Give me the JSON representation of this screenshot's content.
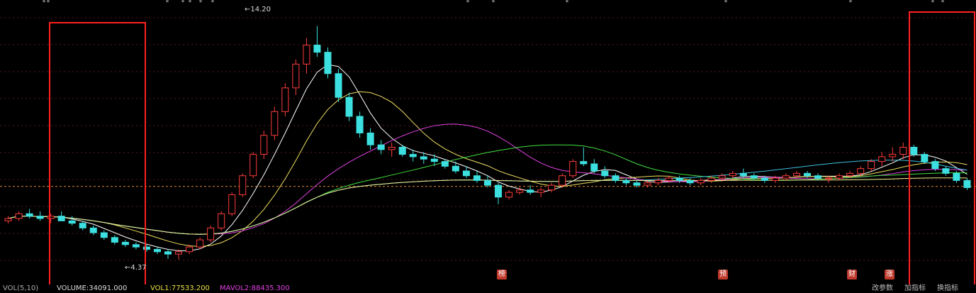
{
  "chart_data": {
    "type": "candlestick",
    "ylim": [
      3.5,
      15.0
    ],
    "high_label": "14.20",
    "low_label": "4.37",
    "reference_price": 7.45,
    "ohlc": [
      [
        6.0,
        6.2,
        5.9,
        6.1
      ],
      [
        6.1,
        6.4,
        6.0,
        6.3
      ],
      [
        6.3,
        6.5,
        6.1,
        6.2
      ],
      [
        6.2,
        6.4,
        6.0,
        6.1
      ],
      [
        6.1,
        6.3,
        5.9,
        6.2
      ],
      [
        6.2,
        6.4,
        6.0,
        6.0
      ],
      [
        6.0,
        6.2,
        5.8,
        5.9
      ],
      [
        5.9,
        6.0,
        5.6,
        5.7
      ],
      [
        5.7,
        5.8,
        5.4,
        5.5
      ],
      [
        5.5,
        5.6,
        5.2,
        5.3
      ],
      [
        5.3,
        5.4,
        5.0,
        5.1
      ],
      [
        5.1,
        5.2,
        4.9,
        5.0
      ],
      [
        5.0,
        5.1,
        4.8,
        4.9
      ],
      [
        4.9,
        5.0,
        4.7,
        4.8
      ],
      [
        4.8,
        4.9,
        4.6,
        4.7
      ],
      [
        4.7,
        4.8,
        4.4,
        4.6
      ],
      [
        4.6,
        4.8,
        4.37,
        4.7
      ],
      [
        4.7,
        5.0,
        4.6,
        4.9
      ],
      [
        4.9,
        5.3,
        4.8,
        5.2
      ],
      [
        5.2,
        5.8,
        5.1,
        5.7
      ],
      [
        5.7,
        6.4,
        5.6,
        6.3
      ],
      [
        6.3,
        7.2,
        6.2,
        7.1
      ],
      [
        7.1,
        8.0,
        7.0,
        7.9
      ],
      [
        7.9,
        8.9,
        7.8,
        8.8
      ],
      [
        8.8,
        9.8,
        8.6,
        9.6
      ],
      [
        9.6,
        10.8,
        9.4,
        10.6
      ],
      [
        10.6,
        11.8,
        10.4,
        11.6
      ],
      [
        11.6,
        12.8,
        11.3,
        12.6
      ],
      [
        12.6,
        13.7,
        12.2,
        13.4
      ],
      [
        13.4,
        14.2,
        12.9,
        13.1
      ],
      [
        13.1,
        13.3,
        12.0,
        12.2
      ],
      [
        12.2,
        12.4,
        11.0,
        11.2
      ],
      [
        11.2,
        11.4,
        10.2,
        10.4
      ],
      [
        10.4,
        10.6,
        9.5,
        9.7
      ],
      [
        9.7,
        9.9,
        9.0,
        9.2
      ],
      [
        9.2,
        9.4,
        8.8,
        9.0
      ],
      [
        9.0,
        9.3,
        8.7,
        9.1
      ],
      [
        9.1,
        9.2,
        8.7,
        8.8
      ],
      [
        8.8,
        9.0,
        8.5,
        8.7
      ],
      [
        8.7,
        8.9,
        8.4,
        8.6
      ],
      [
        8.6,
        8.8,
        8.3,
        8.5
      ],
      [
        8.5,
        8.6,
        8.2,
        8.3
      ],
      [
        8.3,
        8.5,
        8.0,
        8.1
      ],
      [
        8.1,
        8.3,
        7.8,
        7.9
      ],
      [
        7.9,
        8.1,
        7.6,
        7.7
      ],
      [
        7.7,
        7.9,
        7.4,
        7.5
      ],
      [
        7.5,
        7.6,
        6.7,
        7.0
      ],
      [
        7.0,
        7.3,
        6.9,
        7.2
      ],
      [
        7.2,
        7.4,
        7.1,
        7.3
      ],
      [
        7.3,
        7.5,
        7.1,
        7.2
      ],
      [
        7.2,
        7.4,
        7.0,
        7.3
      ],
      [
        7.3,
        7.6,
        7.2,
        7.5
      ],
      [
        7.5,
        8.0,
        7.4,
        7.9
      ],
      [
        7.9,
        8.6,
        7.8,
        8.5
      ],
      [
        8.5,
        9.1,
        8.3,
        8.4
      ],
      [
        8.4,
        8.6,
        8.0,
        8.1
      ],
      [
        8.1,
        8.3,
        7.8,
        7.9
      ],
      [
        7.9,
        8.0,
        7.6,
        7.7
      ],
      [
        7.7,
        7.8,
        7.5,
        7.6
      ],
      [
        7.6,
        7.7,
        7.4,
        7.5
      ],
      [
        7.5,
        7.7,
        7.4,
        7.6
      ],
      [
        7.6,
        7.8,
        7.5,
        7.7
      ],
      [
        7.7,
        7.9,
        7.6,
        7.8
      ],
      [
        7.8,
        7.9,
        7.6,
        7.7
      ],
      [
        7.7,
        7.8,
        7.5,
        7.6
      ],
      [
        7.6,
        7.8,
        7.5,
        7.7
      ],
      [
        7.7,
        7.9,
        7.6,
        7.8
      ],
      [
        7.8,
        8.0,
        7.7,
        7.9
      ],
      [
        7.9,
        8.1,
        7.8,
        8.0
      ],
      [
        8.0,
        8.2,
        7.8,
        7.9
      ],
      [
        7.9,
        8.0,
        7.7,
        7.8
      ],
      [
        7.8,
        7.9,
        7.6,
        7.7
      ],
      [
        7.7,
        7.9,
        7.6,
        7.8
      ],
      [
        7.8,
        8.0,
        7.7,
        7.9
      ],
      [
        7.9,
        8.1,
        7.8,
        8.0
      ],
      [
        8.0,
        8.1,
        7.8,
        7.9
      ],
      [
        7.9,
        8.0,
        7.7,
        7.8
      ],
      [
        7.8,
        7.9,
        7.6,
        7.8
      ],
      [
        7.8,
        8.0,
        7.7,
        7.9
      ],
      [
        7.9,
        8.1,
        7.8,
        8.0
      ],
      [
        8.0,
        8.3,
        7.9,
        8.2
      ],
      [
        8.2,
        8.6,
        8.1,
        8.5
      ],
      [
        8.5,
        8.9,
        8.3,
        8.7
      ],
      [
        8.7,
        9.1,
        8.5,
        8.8
      ],
      [
        8.8,
        9.3,
        8.6,
        9.1
      ],
      [
        9.1,
        9.2,
        8.7,
        8.8
      ],
      [
        8.8,
        8.9,
        8.4,
        8.5
      ],
      [
        8.5,
        8.6,
        8.1,
        8.2
      ],
      [
        8.2,
        8.3,
        7.9,
        8.0
      ],
      [
        8.0,
        8.1,
        7.6,
        7.7
      ],
      [
        7.7,
        7.8,
        7.3,
        7.4
      ]
    ],
    "ma_colors": [
      "#ffffff",
      "#f0e060",
      "#e040e0",
      "#40e040",
      "#40c0e0",
      "#f0f090"
    ],
    "annotation_tags": [
      "榜",
      "预",
      "财",
      "涨"
    ]
  },
  "bottom": {
    "vol_label": "VOL(5,10)",
    "volume_label": "VOLUME:34091.000",
    "vol1_label": "VOL1:77533.200",
    "mavol2_label": "MAVOL2:88435.300",
    "change_params": "改参数",
    "add_indicator": "加指标",
    "change_indicator": "换指标"
  }
}
